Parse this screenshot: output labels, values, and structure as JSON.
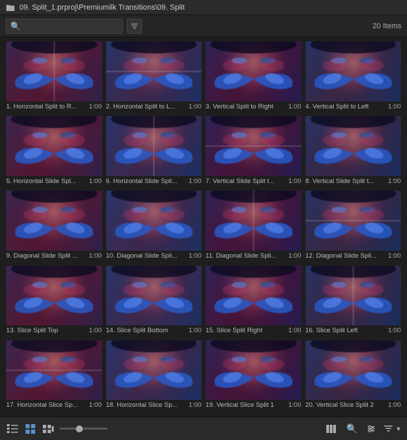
{
  "titlebar": {
    "title": "09. Split_1.prproj\\Premiumilk Transitions\\09. Split"
  },
  "searchbar": {
    "placeholder": "",
    "items_count": "20 Items"
  },
  "items": [
    {
      "id": 1,
      "name": "1. Horizontal Split to R...",
      "duration": "1:00"
    },
    {
      "id": 2,
      "name": "2. Horizontal Split to L...",
      "duration": "1:00"
    },
    {
      "id": 3,
      "name": "3. Vertical Split to Right",
      "duration": "1:00"
    },
    {
      "id": 4,
      "name": "4. Vertical Split to Left",
      "duration": "1:00"
    },
    {
      "id": 5,
      "name": "5. Horizontal Slide Spl...",
      "duration": "1:00"
    },
    {
      "id": 6,
      "name": "6. Horizontal Slide Spli...",
      "duration": "1:00"
    },
    {
      "id": 7,
      "name": "7. Vertical Slide Split t...",
      "duration": "1:00"
    },
    {
      "id": 8,
      "name": "8. Vertical Slide Split t...",
      "duration": "1:00"
    },
    {
      "id": 9,
      "name": "9. Diagonal Slide Split ...",
      "duration": "1:00"
    },
    {
      "id": 10,
      "name": "10. Diagonal Slide Spli...",
      "duration": "1:00"
    },
    {
      "id": 11,
      "name": "11. Diagonal Slide Spli...",
      "duration": "1:00"
    },
    {
      "id": 12,
      "name": "12. Diagonal Slide Spli...",
      "duration": "1:00"
    },
    {
      "id": 13,
      "name": "13. Slice Split Top",
      "duration": "1:00"
    },
    {
      "id": 14,
      "name": "14. Slice Split Bottom",
      "duration": "1:00"
    },
    {
      "id": 15,
      "name": "15. Slice Split Right",
      "duration": "1:00"
    },
    {
      "id": 16,
      "name": "16. Slice Split Left",
      "duration": "1:00"
    },
    {
      "id": 17,
      "name": "17. Horizontal Slice Sp...",
      "duration": "1:00"
    },
    {
      "id": 18,
      "name": "18. Horizontal Slice Sp...",
      "duration": "1:00"
    },
    {
      "id": 19,
      "name": "19. Vertical Slice Split 1",
      "duration": "1:00"
    },
    {
      "id": 20,
      "name": "20. Vertical Slice Split 2",
      "duration": "1:00"
    }
  ],
  "toolbar": {
    "list_view_label": "☰",
    "grid_view_label": "⊞",
    "search_icon": "🔍",
    "filter_icon": "⊟"
  }
}
